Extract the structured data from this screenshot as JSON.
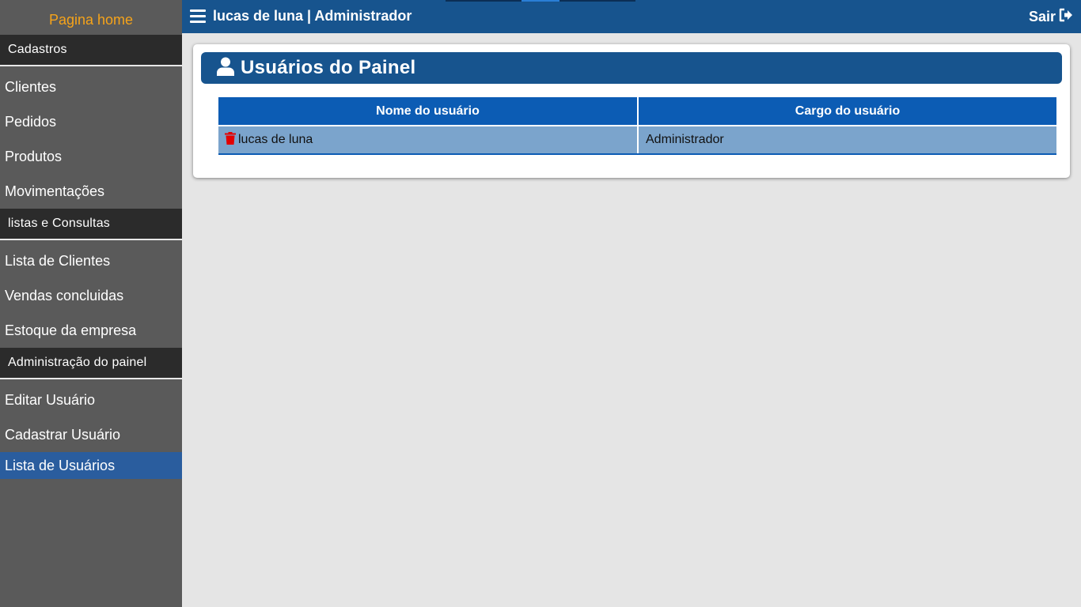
{
  "sidebar": {
    "home": "Pagina home",
    "sections": [
      {
        "title": "Cadastros",
        "items": [
          "Clientes",
          "Pedidos",
          "Produtos",
          "Movimentações"
        ]
      },
      {
        "title": "listas e Consultas",
        "items": [
          "Lista de Clientes",
          "Vendas concluidas",
          "Estoque da empresa"
        ]
      },
      {
        "title": "Administração do painel",
        "items": [
          "Editar Usuário",
          "Cadastrar Usuário",
          "Lista de Usuários"
        ]
      }
    ],
    "active_item": "Lista de Usuários"
  },
  "topbar": {
    "title": "lucas de luna | Administrador",
    "logout_label": "Sair",
    "icons": {
      "menu": "hamburger-icon",
      "logout": "sign-out-icon"
    }
  },
  "panel": {
    "title": "Usuários do Painel",
    "icon": "user-icon",
    "table": {
      "headers": [
        "Nome do usuário",
        "Cargo do usuário"
      ],
      "rows": [
        {
          "name": "lucas de luna",
          "role": "Administrador",
          "action_icon": "trash-icon"
        }
      ]
    }
  },
  "colors": {
    "primary": "#17548e",
    "table_header": "#0c5cb4",
    "row": "#7ba4cc",
    "home_link": "#f5a31a",
    "sidebar": "#5a5a5a",
    "section": "#2b2b2b",
    "active": "#2a5d9e",
    "delete": "#e30000"
  }
}
